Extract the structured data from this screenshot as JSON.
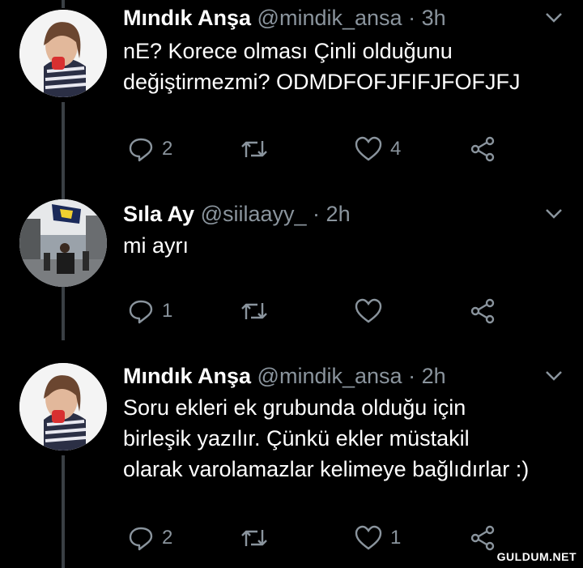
{
  "tweets": [
    {
      "name": "Mındık Anşa",
      "handle": "@mindik_ansa",
      "time": "3h",
      "text_lines": [
        "nE? Korece olması  Çinli olduğunu",
        "değiştirmezmi? ODMDFOFJFIFJFOFJFJ"
      ],
      "replies": "2",
      "retweets": "",
      "likes": "4"
    },
    {
      "name": "Sıla Ay",
      "handle": "@siilaayy_",
      "time": "2h",
      "text_lines": [
        "mi ayrı"
      ],
      "replies": "1",
      "retweets": "",
      "likes": ""
    },
    {
      "name": "Mındık Anşa",
      "handle": "@mindik_ansa",
      "time": "2h",
      "text_lines": [
        "Soru ekleri ek grubunda olduğu için",
        "birleşik yazılır. Çünkü ekler müstakil",
        "olarak varolamazlar kelimeye bağlıdırlar :)"
      ],
      "replies": "2",
      "retweets": "",
      "likes": "1"
    }
  ],
  "separator": "·",
  "watermark": "GULDUM.NET",
  "colors": {
    "background": "#000000",
    "muted": "#8a949d",
    "text": "#ffffff",
    "thread": "#3a3f44"
  },
  "icons": [
    "reply-icon",
    "retweet-icon",
    "like-icon",
    "share-icon",
    "chevron-down-icon"
  ]
}
